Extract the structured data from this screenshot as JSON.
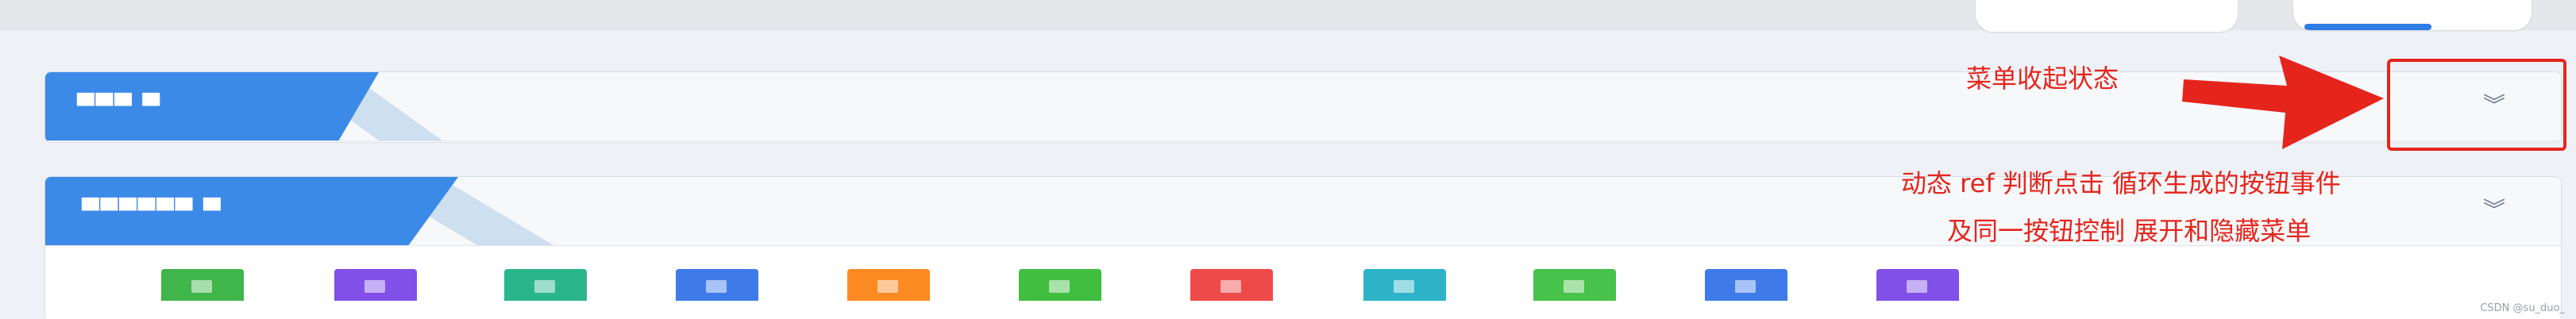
{
  "panels": [
    {
      "title": "▀▀▀ ▀",
      "collapsed": true
    },
    {
      "title": "▀▀▀▀▀▀ ▀",
      "collapsed": false
    }
  ],
  "chevron_glyph": "︾",
  "annotations": {
    "collapsed_state": "菜单收起状态",
    "line1": "动态 ref 判断点击 循环生成的按钮事件",
    "line2": "及同一按钮控制  展开和隐藏菜单"
  },
  "watermark": "CSDN @su_duo_",
  "colors": {
    "accent": "#3b8ae8",
    "annotation": "#e5251d",
    "tiles": [
      "#3fb54a",
      "#8150e8",
      "#2bb58a",
      "#3f7be8",
      "#fb8a22",
      "#3fbe3f",
      "#ef4a4a",
      "#2cb3c8",
      "#47c24a",
      "#3f7be8",
      "#8150e8"
    ]
  }
}
